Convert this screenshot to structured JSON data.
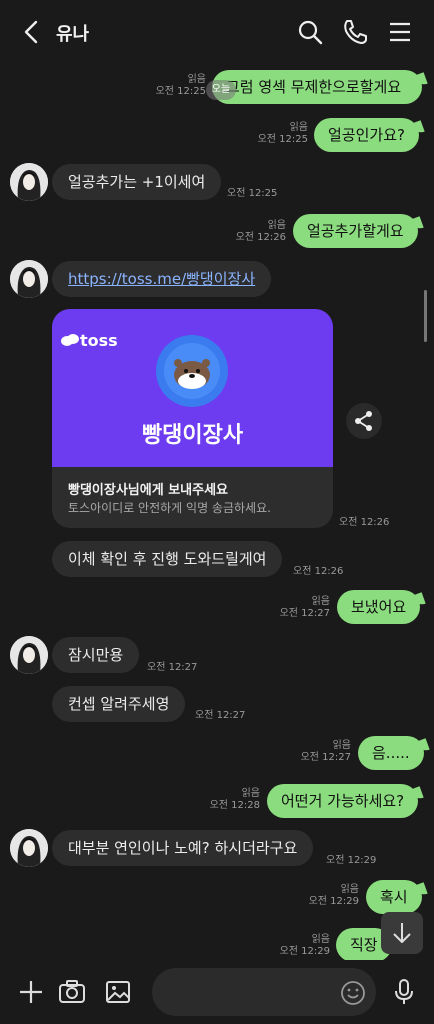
{
  "header": {
    "title": "유나"
  },
  "messages": {
    "m1": {
      "text": "그럼 영섹 무제한으로할게요",
      "read": "읽음",
      "time": "오전 12:25",
      "overlay": "오늘"
    },
    "m2": {
      "text": "얼공인가요?",
      "read": "읽음",
      "time": "오전 12:25"
    },
    "m3": {
      "text": "얼공추가는 +1이세여",
      "time": "오전 12:25"
    },
    "m4": {
      "text": "얼공추가할게요",
      "read": "읽음",
      "time": "오전 12:26"
    },
    "m5": {
      "link": "https://toss.me/빵댕이장사"
    },
    "card": {
      "brand": "toss",
      "name": "빵댕이장사",
      "title": "빵댕이장사님에게 보내주세요",
      "subtitle": "토스아이디로 안전하게 익명 송금하세요.",
      "time": "오전 12:26"
    },
    "m6": {
      "text": "이체 확인 후 진행 도와드릴게여",
      "time": "오전 12:26"
    },
    "m7": {
      "text": "보냈어요",
      "read": "읽음",
      "time": "오전 12:27"
    },
    "m8": {
      "text": "잠시만용",
      "time": "오전 12:27"
    },
    "m9": {
      "text": "컨셉 알려주세영",
      "time": "오전 12:27"
    },
    "m10": {
      "text": "음.....",
      "read": "읽음",
      "time": "오전 12:27"
    },
    "m11": {
      "text": "어떤거 가능하세요?",
      "read": "읽음",
      "time": "오전 12:28"
    },
    "m12": {
      "text": "대부분 연인이나 노예? 하시더라구요",
      "time": "오전 12:29"
    },
    "m13": {
      "text": "혹시",
      "read": "읽음",
      "time": "오전 12:29"
    },
    "m14": {
      "text": "직장",
      "read": "읽음",
      "time": "오전 12:29"
    }
  },
  "composer": {
    "placeholder": ""
  },
  "colors": {
    "background": "#1a1a1a",
    "my_bubble": "#8bdc7e",
    "their_bubble": "#2d2d2d",
    "toss_purple": "#6d3cf0",
    "link": "#8ab4ff"
  },
  "icons": [
    "back-arrow-icon",
    "search-icon",
    "phone-icon",
    "menu-icon",
    "share-icon",
    "plus-icon",
    "camera-icon",
    "image-icon",
    "emoji-icon",
    "mic-icon",
    "arrow-down-icon"
  ]
}
